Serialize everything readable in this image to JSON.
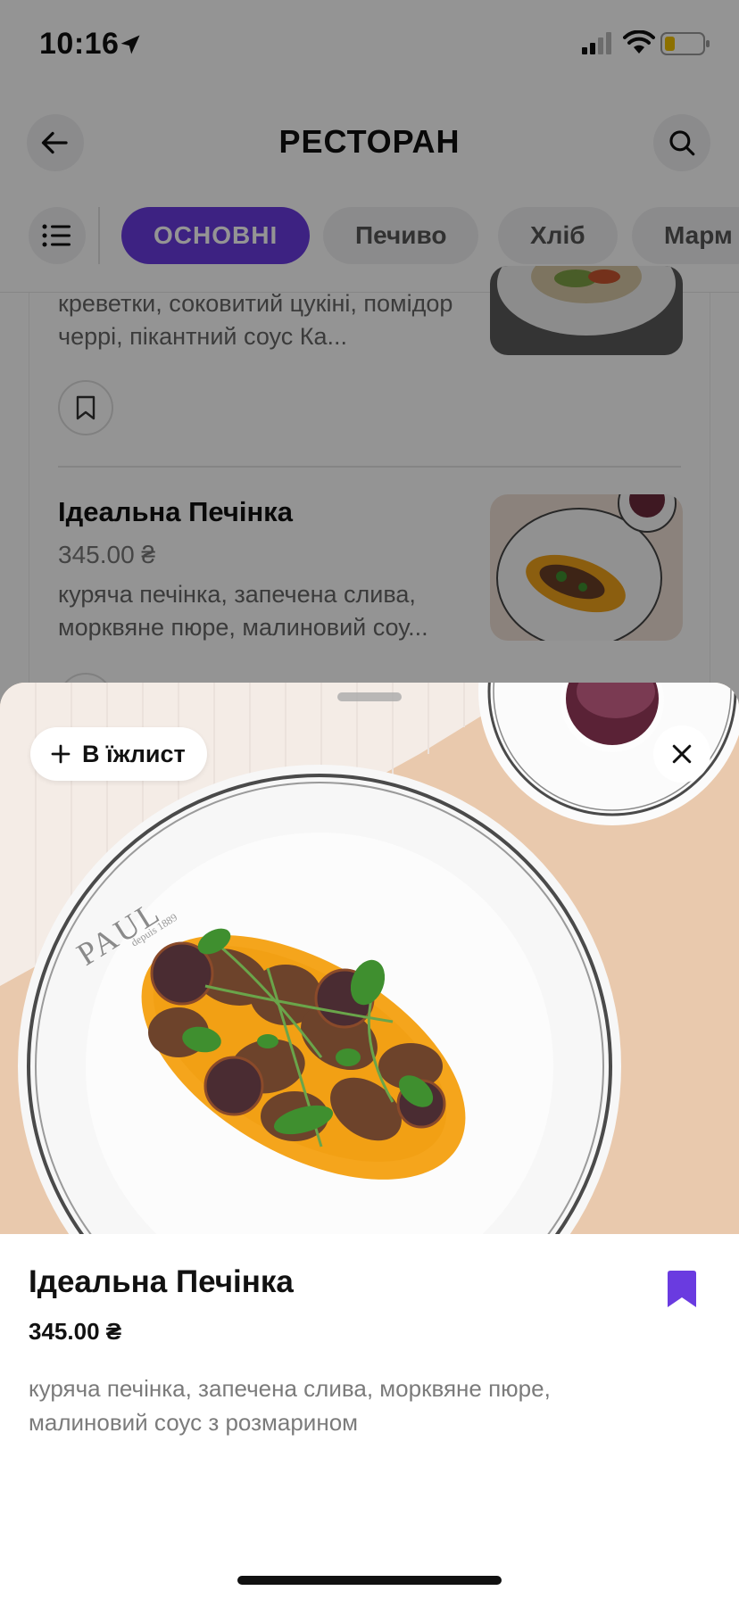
{
  "status_bar": {
    "time": "10:16"
  },
  "header": {
    "title": "РЕСТОРАН"
  },
  "tabs": [
    {
      "label": "ОСНОВНІ",
      "active": true
    },
    {
      "label": "Печиво",
      "active": false
    },
    {
      "label": "Хліб",
      "active": false
    },
    {
      "label": "Марм",
      "active": false
    }
  ],
  "list": {
    "prev_item_desc": "креветки, соковитий цукіні, помідор черрі, пікантний соус Ка...",
    "item": {
      "name": "Ідеальна Печінка",
      "price": "345.00 ₴",
      "desc": "куряча печінка, запечена слива, морквяне пюре, малиновий соу..."
    }
  },
  "sheet": {
    "add_label": "В їжлист",
    "dish_name": "Ідеальна Печінка",
    "price": "345.00 ₴",
    "description": "куряча печінка, запечена слива, морквяне пюре, малиновий соус з розмарином",
    "plate_brand": "PAUL",
    "plate_tagline": "depuis 1889",
    "bookmarked": true
  },
  "colors": {
    "accent": "#6a3be0"
  }
}
